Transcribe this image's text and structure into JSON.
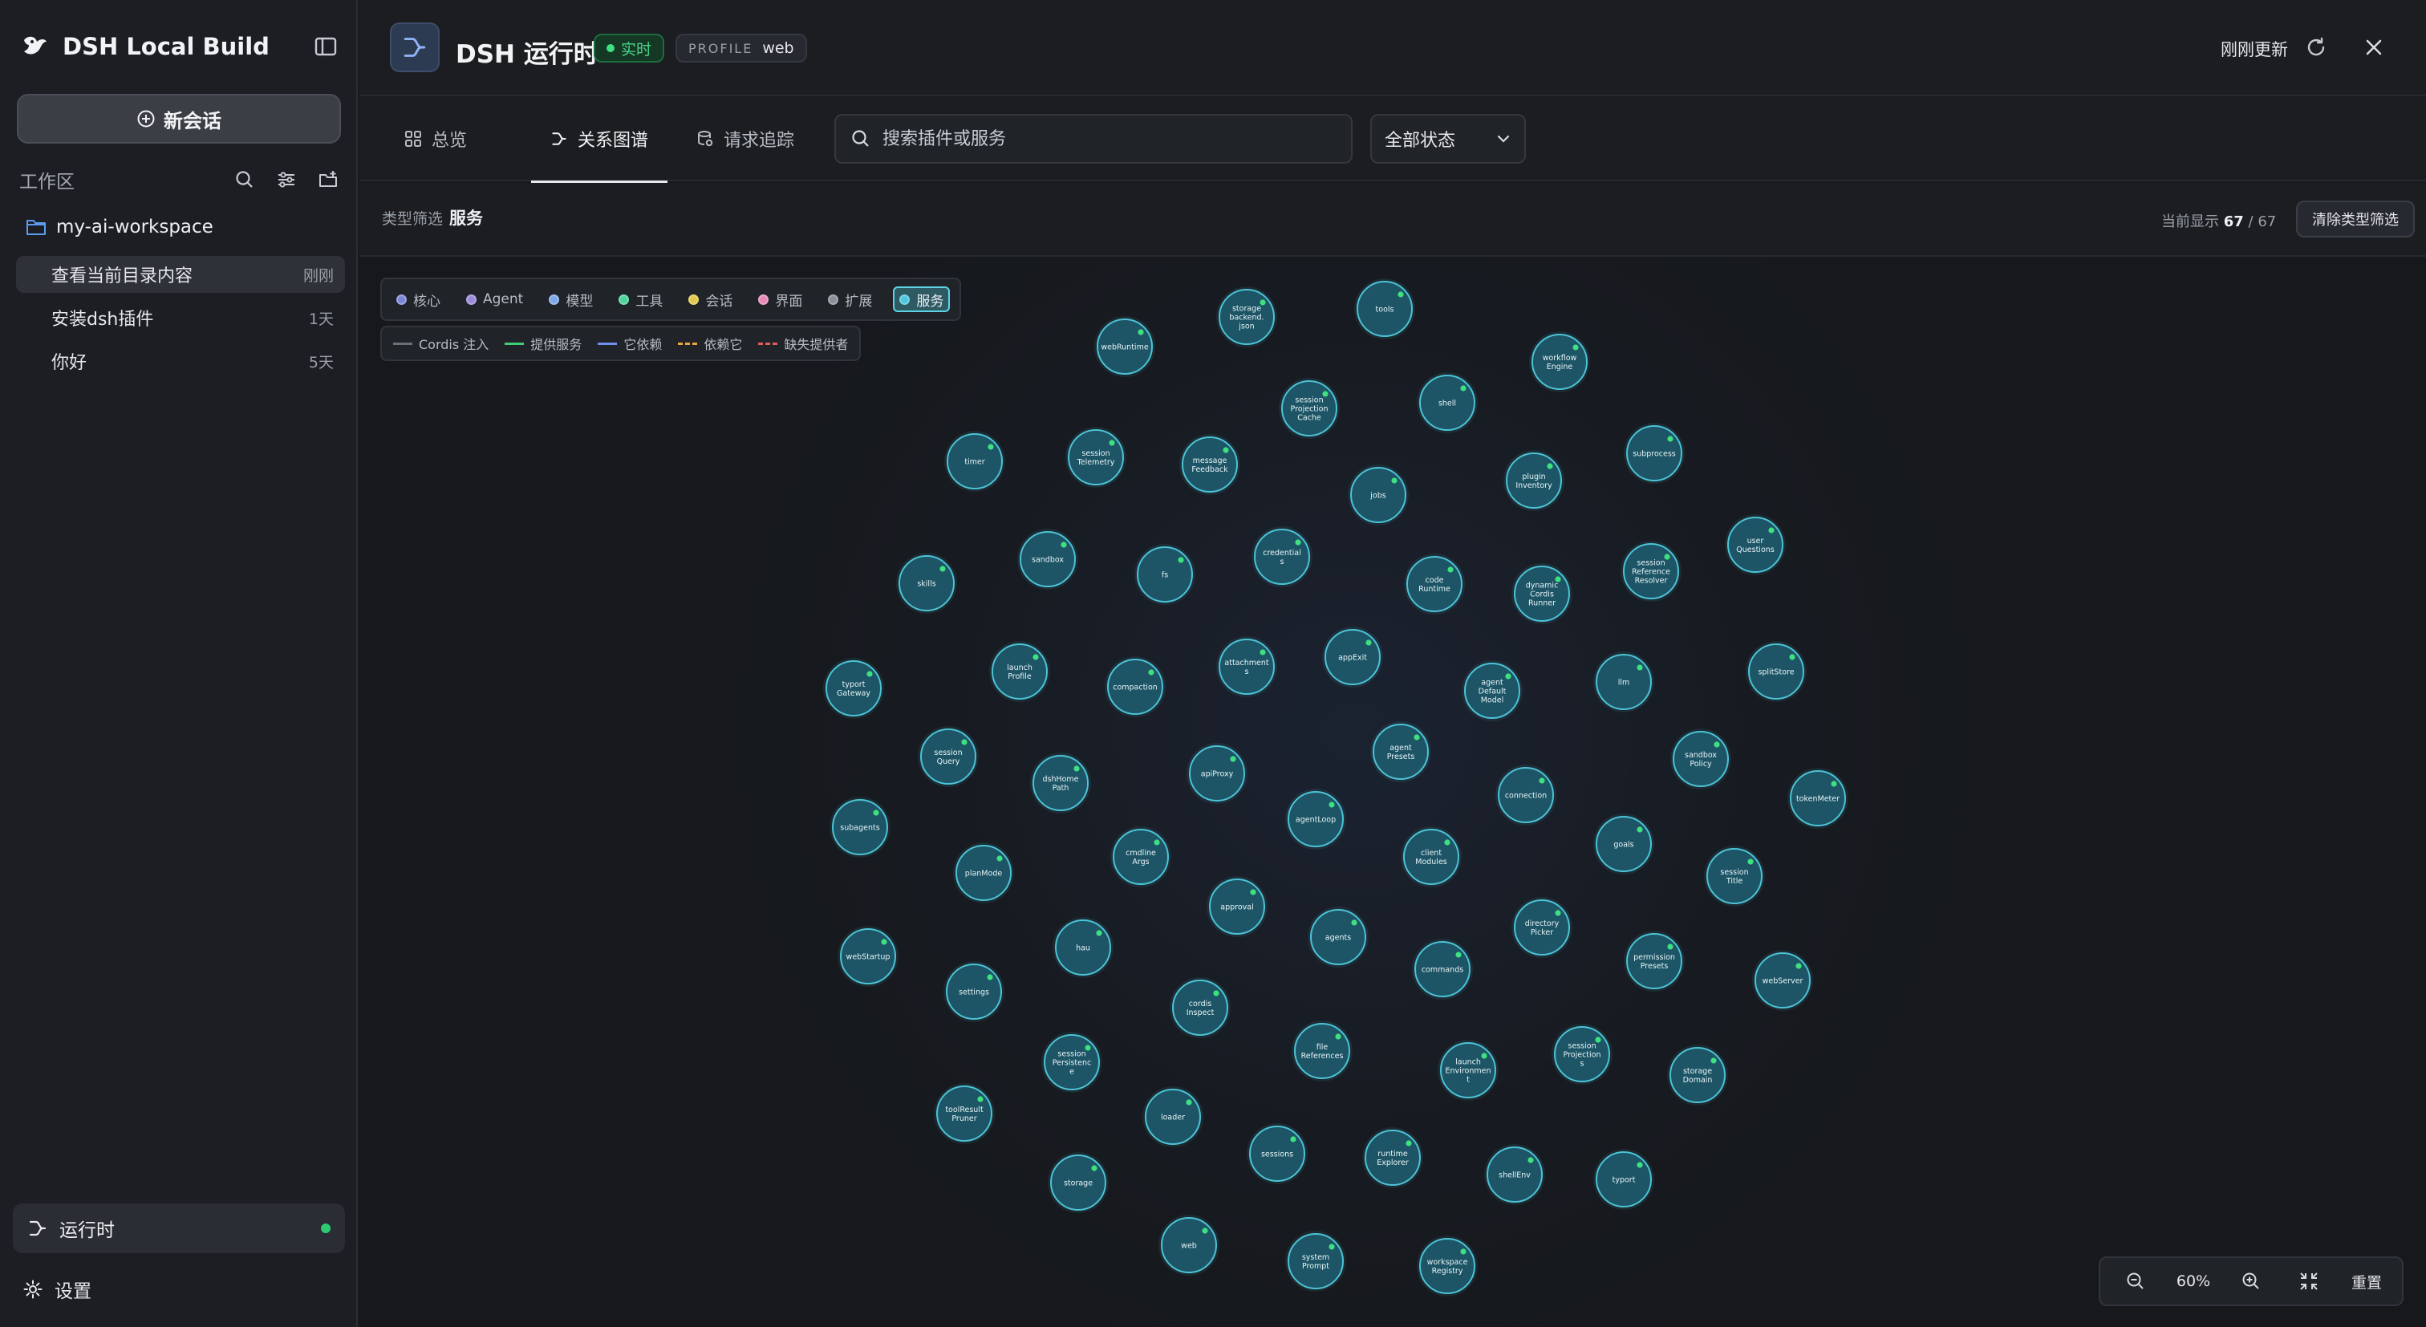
{
  "sidebar": {
    "brand": "DSH Local Build",
    "new_session": "新会话",
    "workspace_label": "工作区",
    "folder": "my-ai-workspace",
    "sessions": [
      {
        "title": "查看当前目录内容",
        "time": "刚刚"
      },
      {
        "title": "安装dsh插件",
        "time": "1天"
      },
      {
        "title": "你好",
        "time": "5天"
      }
    ],
    "runtime": "运行时",
    "settings": "设置"
  },
  "header": {
    "title": "DSH 运行时",
    "live": "实时",
    "profile_key": "PROFILE",
    "profile_value": "web",
    "updated": "刚刚更新"
  },
  "tabs": [
    {
      "label": "总览"
    },
    {
      "label": "关系图谱"
    },
    {
      "label": "请求追踪"
    }
  ],
  "search": {
    "placeholder": "搜索插件或服务"
  },
  "status_filter": {
    "value": "全部状态"
  },
  "type_filter": {
    "label": "类型筛选",
    "value": "服务"
  },
  "count": {
    "label": "当前显示",
    "shown": "67",
    "total": "67"
  },
  "clear_filter": "清除类型筛选",
  "legend_types": [
    {
      "label": "核心",
      "color": "#7c86d6"
    },
    {
      "label": "Agent",
      "color": "#9a8bd8"
    },
    {
      "label": "模型",
      "color": "#7fa7e6"
    },
    {
      "label": "工具",
      "color": "#4fd29a"
    },
    {
      "label": "会话",
      "color": "#e3c74a"
    },
    {
      "label": "界面",
      "color": "#e58ab8"
    },
    {
      "label": "扩展",
      "color": "#8a8f98"
    },
    {
      "label": "服务",
      "color": "#4ec6dc",
      "active": true
    }
  ],
  "legend_edges": [
    {
      "label": "Cordis 注入",
      "color": "#6b7078",
      "style": "solid"
    },
    {
      "label": "提供服务",
      "color": "#3ecf76",
      "style": "solid"
    },
    {
      "label": "它依赖",
      "color": "#6f8ff0",
      "style": "solid"
    },
    {
      "label": "依赖它",
      "color": "#f0a53a",
      "style": "dashed"
    },
    {
      "label": "缺失提供者",
      "color": "#e35d5d",
      "style": "dashed"
    }
  ],
  "zoom": {
    "level": "60%",
    "reset": "重置"
  },
  "colors": {
    "node_fill": "#1d5566",
    "node_stroke": "#4cc3d6",
    "status_ok": "#3ee07f"
  },
  "nodes": [
    {
      "lines": [
        "storage",
        "backend.",
        "json"
      ]
    },
    {
      "lines": [
        "tools"
      ]
    },
    {
      "lines": [
        "webRuntime"
      ]
    },
    {
      "lines": [
        "workflow",
        "Engine"
      ]
    },
    {
      "lines": [
        "session",
        "Projection",
        "Cache"
      ]
    },
    {
      "lines": [
        "shell"
      ]
    },
    {
      "lines": [
        "timer"
      ]
    },
    {
      "lines": [
        "session",
        "Telemetry"
      ]
    },
    {
      "lines": [
        "message",
        "Feedback"
      ]
    },
    {
      "lines": [
        "subprocess"
      ]
    },
    {
      "lines": [
        "jobs"
      ]
    },
    {
      "lines": [
        "plugin",
        "Inventory"
      ]
    },
    {
      "lines": [
        "user",
        "Questions"
      ]
    },
    {
      "lines": [
        "sandbox"
      ]
    },
    {
      "lines": [
        "credential",
        "s"
      ]
    },
    {
      "lines": [
        "skills"
      ]
    },
    {
      "lines": [
        "fs"
      ]
    },
    {
      "lines": [
        "code",
        "Runtime"
      ]
    },
    {
      "lines": [
        "session",
        "Reference",
        "Resolver"
      ]
    },
    {
      "lines": [
        "dynamic",
        "Cordis",
        "Runner"
      ]
    },
    {
      "lines": [
        "appExit"
      ]
    },
    {
      "lines": [
        "launch",
        "Profile"
      ]
    },
    {
      "lines": [
        "attachment",
        "s"
      ]
    },
    {
      "lines": [
        "typort",
        "Gateway"
      ]
    },
    {
      "lines": [
        "compaction"
      ]
    },
    {
      "lines": [
        "agent",
        "Default",
        "Model"
      ]
    },
    {
      "lines": [
        "llm"
      ]
    },
    {
      "lines": [
        "splitStore"
      ]
    },
    {
      "lines": [
        "agent",
        "Presets"
      ]
    },
    {
      "lines": [
        "session",
        "Query"
      ]
    },
    {
      "lines": [
        "sandbox",
        "Policy"
      ]
    },
    {
      "lines": [
        "dshHome",
        "Path"
      ]
    },
    {
      "lines": [
        "apiProxy"
      ]
    },
    {
      "lines": [
        "tokenMeter"
      ]
    },
    {
      "lines": [
        "connection"
      ]
    },
    {
      "lines": [
        "agentLoop"
      ]
    },
    {
      "lines": [
        "subagents"
      ]
    },
    {
      "lines": [
        "goals"
      ]
    },
    {
      "lines": [
        "cmdline",
        "Args"
      ]
    },
    {
      "lines": [
        "client",
        "Modules"
      ]
    },
    {
      "lines": [
        "planMode"
      ]
    },
    {
      "lines": [
        "session",
        "Title"
      ]
    },
    {
      "lines": [
        "approval"
      ]
    },
    {
      "lines": [
        "directory",
        "Picker"
      ]
    },
    {
      "lines": [
        "agents"
      ]
    },
    {
      "lines": [
        "webStartup"
      ]
    },
    {
      "lines": [
        "hau"
      ]
    },
    {
      "lines": [
        "permission",
        "Presets"
      ]
    },
    {
      "lines": [
        "commands"
      ]
    },
    {
      "lines": [
        "webServer"
      ]
    },
    {
      "lines": [
        "settings"
      ]
    },
    {
      "lines": [
        "cordis",
        "Inspect"
      ]
    },
    {
      "lines": [
        "file",
        "References"
      ]
    },
    {
      "lines": [
        "session",
        "Projection",
        "s"
      ]
    },
    {
      "lines": [
        "session",
        "Persistenc",
        "e"
      ]
    },
    {
      "lines": [
        "launch",
        "Environmen",
        "t"
      ]
    },
    {
      "lines": [
        "storage",
        "Domain"
      ]
    },
    {
      "lines": [
        "toolResult",
        "Pruner"
      ]
    },
    {
      "lines": [
        "loader"
      ]
    },
    {
      "lines": [
        "sessions"
      ]
    },
    {
      "lines": [
        "runtime",
        "Explorer"
      ]
    },
    {
      "lines": [
        "shellEnv"
      ]
    },
    {
      "lines": [
        "typort"
      ]
    },
    {
      "lines": [
        "storage"
      ]
    },
    {
      "lines": [
        "web"
      ]
    },
    {
      "lines": [
        "system",
        "Prompt"
      ]
    },
    {
      "lines": [
        "workspace",
        "Registry"
      ]
    }
  ]
}
